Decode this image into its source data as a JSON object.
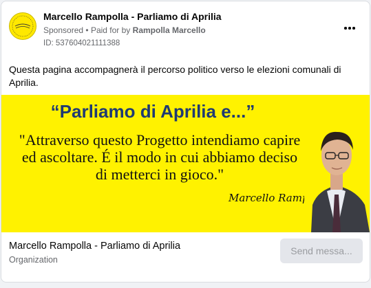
{
  "post": {
    "page_name": "Marcello Rampolla - Parliamo di Aprilia",
    "sponsored_label": "Sponsored",
    "separator": "•",
    "paid_for_prefix": "Paid for by",
    "paid_for_name": "Rampolla Marcello",
    "ad_id": "ID: 537604021111388",
    "body_text": "Questa pagina accompagnerà il percorso politico verso le elezioni comunali di Aprilia.",
    "more_icon": "more-horizontal-icon"
  },
  "creative": {
    "title": "“Parliamo di Aprilia e...”",
    "quote_lines": [
      "\"Attraverso questo Progetto intendiamo capire",
      "ed ascoltare. É il modo in cui abbiamo deciso",
      "di metterci in gioco.\""
    ],
    "signature": "Marcello Rampolla",
    "background_color": "#fff200",
    "title_color": "#1f3a73"
  },
  "footer": {
    "title": "Marcello Rampolla - Parliamo di Aprilia",
    "subtitle": "Organization",
    "cta_label": "Send messa..."
  }
}
